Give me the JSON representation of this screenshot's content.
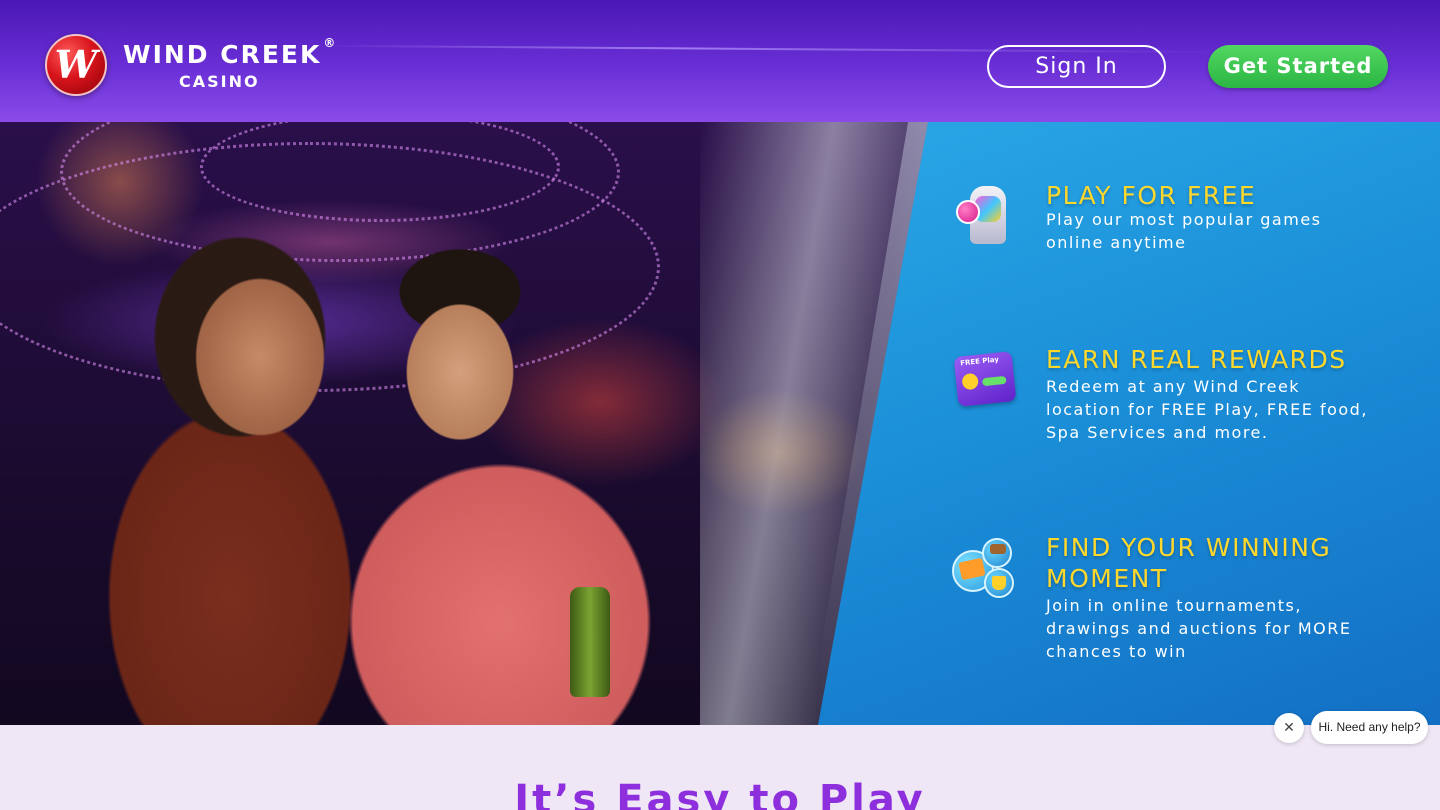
{
  "header": {
    "brand_name": "WIND CREEK",
    "brand_reg": "®",
    "brand_sub": "CASINO",
    "logo_mark": "W",
    "signin_label": "Sign In",
    "get_started_label": "Get Started"
  },
  "features": [
    {
      "icon": "slot-machine-icon",
      "title": "PLAY FOR FREE",
      "description": "Play our most popular games online anytime"
    },
    {
      "icon": "free-play-card-icon",
      "icon_label": "FREE Play",
      "title": "EARN REAL REWARDS",
      "description": "Redeem at any Wind Creek location for FREE Play, FREE food, Spa Services and more."
    },
    {
      "icon": "tournaments-icon",
      "title": "FIND YOUR WINNING MOMENT",
      "description": "Join in online tournaments, drawings and auctions for MORE chances to win"
    }
  ],
  "section": {
    "title": "It’s Easy to Play"
  },
  "chat": {
    "close_glyph": "✕",
    "message": "Hi. Need any help?"
  },
  "colors": {
    "header_purple": "#5a22c8",
    "accent_green": "#2bb543",
    "feature_yellow": "#ffd82b",
    "panel_blue": "#1b8fd8",
    "section_title_purple": "#8d2fdc"
  }
}
